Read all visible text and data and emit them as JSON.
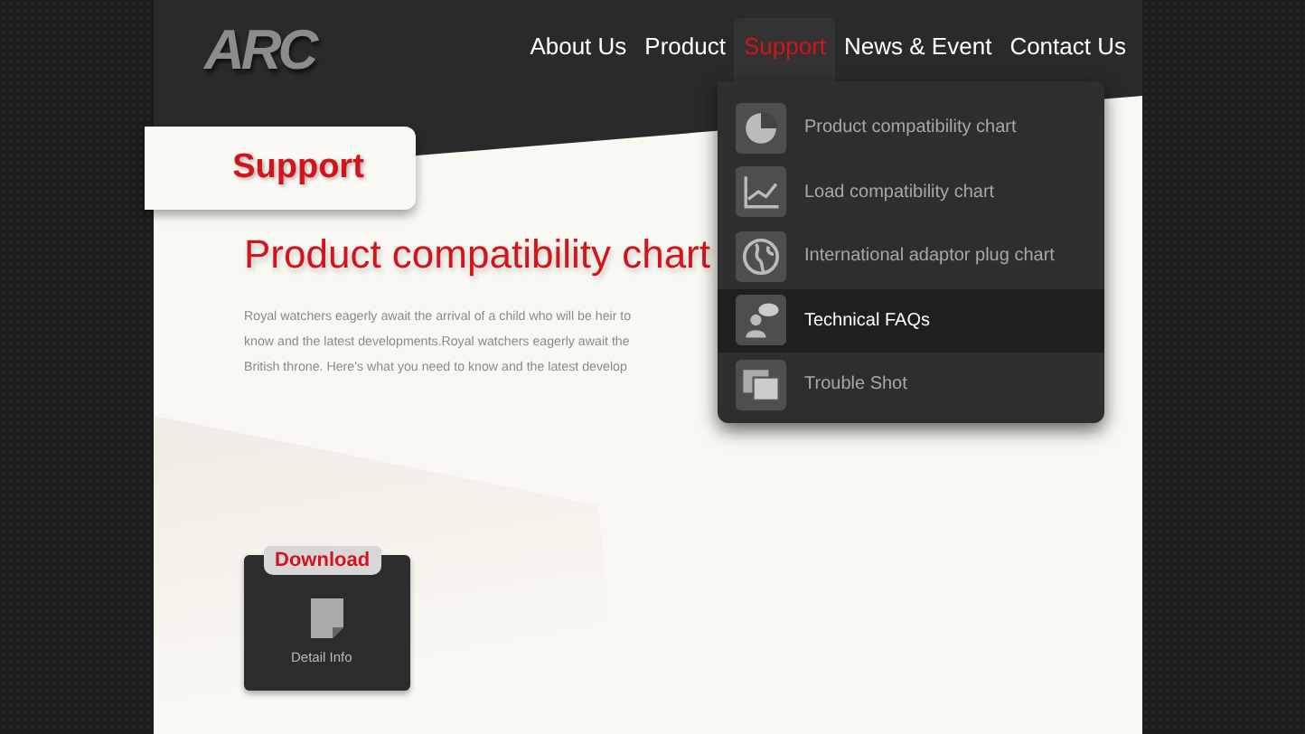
{
  "logo": "ARC",
  "nav": [
    {
      "label": "About Us",
      "selected": false
    },
    {
      "label": "Product",
      "selected": false
    },
    {
      "label": "Support",
      "selected": true
    },
    {
      "label": "News & Event",
      "selected": false
    },
    {
      "label": "Contact Us",
      "selected": false
    }
  ],
  "dropdown": [
    {
      "label": "Product compatibility chart",
      "kind": "pie",
      "selected": false
    },
    {
      "label": "Load compatibility chart",
      "kind": "line",
      "selected": false
    },
    {
      "label": "International adaptor plug chart",
      "kind": "globe",
      "selected": false
    },
    {
      "label": "Technical FAQs",
      "kind": "person",
      "selected": true
    },
    {
      "label": "Trouble Shot",
      "kind": "photos",
      "selected": false
    }
  ],
  "section_tab": "Support",
  "heading": "Product compatibility chart",
  "paragraph_lines": [
    "Royal watchers eagerly await the arrival of a child who will be heir to",
    "know and the latest developments.Royal watchers eagerly await the",
    "British throne. Here's what you need to know and the latest develop"
  ],
  "download_card": {
    "tab": "Download",
    "label": "Detail Info"
  }
}
